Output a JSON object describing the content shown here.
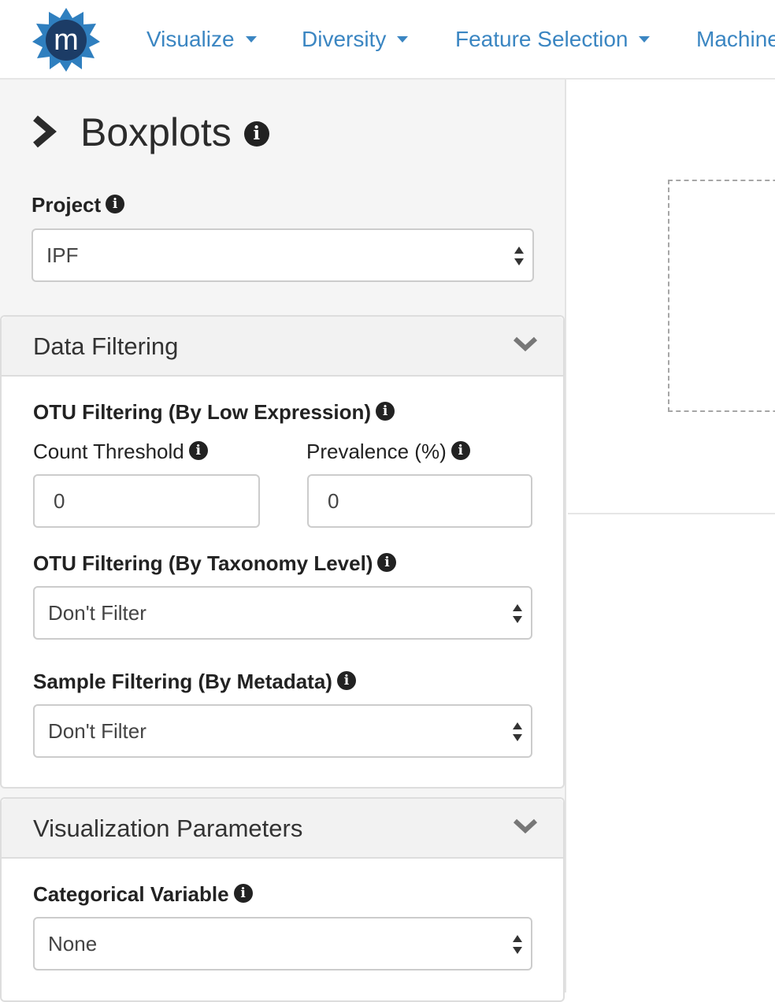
{
  "navbar": {
    "logo_letter": "m",
    "items": [
      {
        "label": "Visualize",
        "has_caret": true
      },
      {
        "label": "Diversity",
        "has_caret": true
      },
      {
        "label": "Feature Selection",
        "has_caret": true
      },
      {
        "label": "Machine",
        "has_caret": false
      }
    ]
  },
  "sidebar": {
    "title": "Boxplots",
    "title_info_icon": "info-icon",
    "project": {
      "label": "Project",
      "selected": "IPF"
    }
  },
  "data_filtering": {
    "title": "Data Filtering",
    "otu_low_expression": {
      "label": "OTU Filtering (By Low Expression)",
      "count_threshold": {
        "label": "Count Threshold",
        "value": "0"
      },
      "prevalence": {
        "label": "Prevalence (%)",
        "value": "0"
      }
    },
    "otu_taxonomy": {
      "label": "OTU Filtering (By Taxonomy Level)",
      "selected": "Don't Filter"
    },
    "sample_metadata": {
      "label": "Sample Filtering (By Metadata)",
      "selected": "Don't Filter"
    }
  },
  "visualization_parameters": {
    "title": "Visualization Parameters",
    "categorical_variable": {
      "label": "Categorical Variable",
      "selected": "None"
    }
  },
  "colors": {
    "link_blue": "#3b86c2",
    "logo_navy": "#1c3c66",
    "logo_blue": "#2f7fbf"
  }
}
